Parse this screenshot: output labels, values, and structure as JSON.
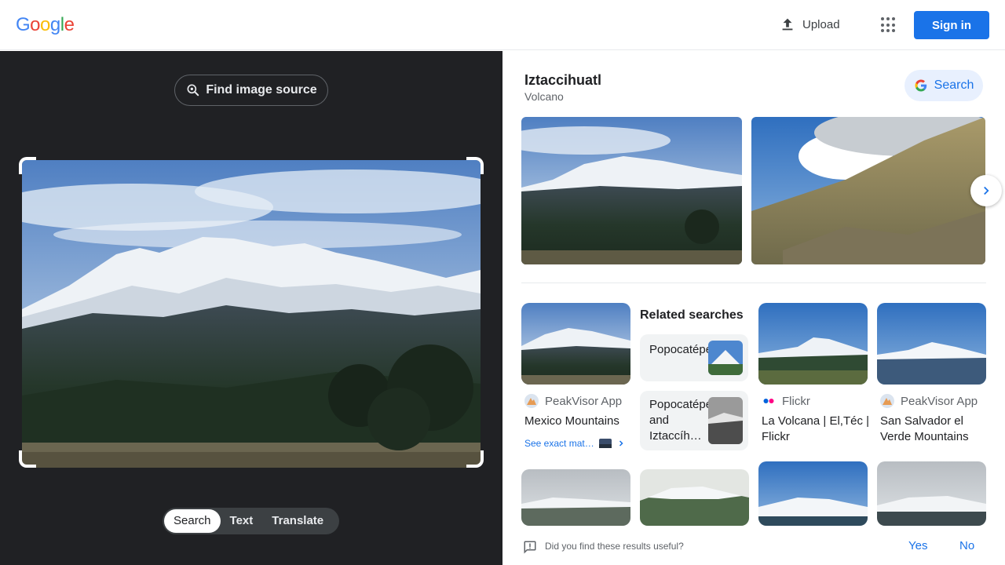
{
  "header": {
    "logo_letters": [
      {
        "ch": "G",
        "color": "#4285f4"
      },
      {
        "ch": "o",
        "color": "#ea4335"
      },
      {
        "ch": "o",
        "color": "#fbbc05"
      },
      {
        "ch": "g",
        "color": "#4285f4"
      },
      {
        "ch": "l",
        "color": "#34a853"
      },
      {
        "ch": "e",
        "color": "#ea4335"
      }
    ],
    "upload_label": "Upload",
    "signin_label": "Sign in",
    "apps_icon": "grid-dots-icon"
  },
  "left": {
    "find_source_label": "Find image source",
    "modes": [
      "Search",
      "Text",
      "Translate"
    ],
    "active_mode": "Search"
  },
  "entity": {
    "title": "Iztaccihuatl",
    "subtitle": "Volcano",
    "search_label": "Search"
  },
  "results": [
    {
      "source": "PeakVisor App",
      "title": "Mexico Mountains",
      "see_exact": "See exact mat…"
    },
    {
      "source": "Flickr",
      "title": "La Volcana | El,Téc | Flickr"
    },
    {
      "source": "PeakVisor App",
      "title": "San Salvador el Verde Mountains"
    }
  ],
  "related": {
    "title": "Related searches",
    "items": [
      "Popocatépetl",
      "Popocatépetl and Iztaccíh…"
    ]
  },
  "feedback": {
    "question": "Did you find these results useful?",
    "yes": "Yes",
    "no": "No"
  },
  "colors": {
    "accent": "#1a73e8",
    "dark_panel": "#202124"
  }
}
